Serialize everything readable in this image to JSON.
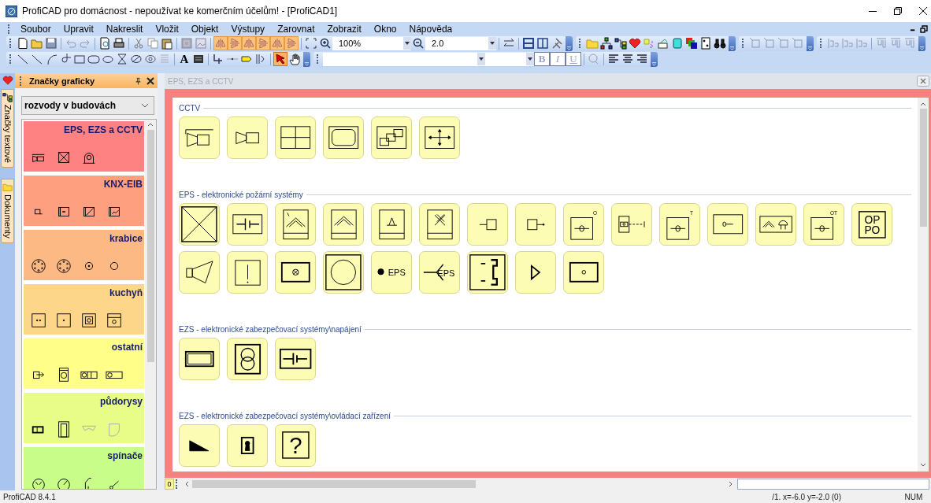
{
  "window": {
    "title": "ProfiCAD pro domácnost - nepoužívat ke komerčním účelům! - [ProfiCAD1]"
  },
  "menu": [
    "Soubor",
    "Upravit",
    "Nakreslit",
    "Vložit",
    "Objekt",
    "Výstupy",
    "Zarovnat",
    "Zobrazit",
    "Okno",
    "Nápověda"
  ],
  "toolbar": {
    "zoom": "100%",
    "grid": "2.0"
  },
  "drawing_toolbar": [
    {
      "kind": "line",
      "selected": false
    },
    {
      "kind": "polyline",
      "selected": false
    },
    {
      "kind": "arc",
      "selected": false
    },
    {
      "kind": "curve",
      "selected": false
    },
    {
      "kind": "rect",
      "selected": false
    },
    {
      "kind": "roundrect",
      "selected": false
    },
    {
      "kind": "ellipse",
      "selected": false
    },
    {
      "kind": "hourglass",
      "selected": false
    },
    {
      "kind": "slashcircle",
      "selected": false
    },
    {
      "kind": "eyecircle",
      "selected": false
    },
    {
      "kind": "lines",
      "selected": false
    },
    {
      "kind": "text",
      "label": "A",
      "selected": false
    },
    {
      "kind": "textbox",
      "selected": false
    },
    {
      "kind": "wire",
      "selected": false
    },
    {
      "kind": "node",
      "selected": false
    },
    {
      "kind": "tag",
      "selected": false
    },
    {
      "kind": "bus",
      "selected": false
    },
    {
      "kind": "pointer",
      "selected": true
    },
    {
      "kind": "hand",
      "selected": false
    }
  ],
  "format_toolbar": [
    {
      "kind": "bold",
      "label": "B",
      "disabled": true
    },
    {
      "kind": "italic",
      "label": "I",
      "disabled": true
    },
    {
      "kind": "underline",
      "label": "U",
      "disabled": true
    }
  ],
  "side_tabs": [
    {
      "label": "Značky textové"
    },
    {
      "label": "Dokumenty"
    }
  ],
  "panel": {
    "title": "Značky graficky",
    "library": "rozvody v budovách",
    "categories": [
      {
        "title": "EPS, EZS a CCTV",
        "color": "#ff8282",
        "symbols": [
          {
            "kind": "cam"
          },
          {
            "kind": "xbox"
          },
          {
            "kind": "dome"
          }
        ]
      },
      {
        "title": "KNX-EIB",
        "color": "#fe9f80",
        "symbols": [
          {
            "kind": "knxa"
          },
          {
            "kind": "knxb"
          },
          {
            "kind": "knxc"
          },
          {
            "kind": "knxd"
          }
        ]
      },
      {
        "title": "krabice",
        "color": "#fdb983",
        "symbols": [
          {
            "kind": "circle6"
          },
          {
            "kind": "circle6"
          },
          {
            "kind": "circledot"
          },
          {
            "kind": "circle"
          }
        ]
      },
      {
        "title": "kuchyň",
        "color": "#fed68a",
        "symbols": [
          {
            "kind": "socket2"
          },
          {
            "kind": "socket1"
          },
          {
            "kind": "socketring"
          },
          {
            "kind": "oven"
          }
        ]
      },
      {
        "title": "ostatní",
        "color": "#fefe88",
        "symbols": [
          {
            "kind": "plug"
          },
          {
            "kind": "clock"
          },
          {
            "kind": "washer2"
          },
          {
            "kind": "washer1"
          }
        ]
      },
      {
        "title": "půdorysy",
        "color": "#e8fd88",
        "symbols": [
          {
            "kind": "window"
          },
          {
            "kind": "door"
          },
          {
            "kind": "sink"
          },
          {
            "kind": "bath"
          }
        ]
      },
      {
        "title": "spínače",
        "color": "#c8fd8a",
        "symbols": [
          {
            "kind": "swdouble"
          },
          {
            "kind": "swdial"
          },
          {
            "kind": "swbent"
          },
          {
            "kind": "swkey"
          }
        ]
      }
    ]
  },
  "document": {
    "tab": "EPS, EZS a CCTV",
    "sections": [
      {
        "title": "CCTV",
        "symbols": [
          {
            "kind": "camera_housing"
          },
          {
            "kind": "camera"
          },
          {
            "kind": "monitor_cross"
          },
          {
            "kind": "monitor_rounded"
          },
          {
            "kind": "monitor_split"
          },
          {
            "kind": "monitor_arrows"
          }
        ]
      },
      {
        "title": "EPS - elektronické požární systémy",
        "symbols": [
          {
            "kind": "x_box"
          },
          {
            "kind": "battery_box"
          },
          {
            "kind": "smoke_detector"
          },
          {
            "kind": "chevron_detector"
          },
          {
            "kind": "flame_detector"
          },
          {
            "kind": "star_detector"
          },
          {
            "kind": "port_left"
          },
          {
            "kind": "port_right"
          },
          {
            "kind": "circle_line_box",
            "tag": "O"
          },
          {
            "kind": "rod_box"
          },
          {
            "kind": "circle_line_box",
            "tag": "T"
          },
          {
            "kind": "key_box"
          },
          {
            "kind": "chevron_mushroom"
          },
          {
            "kind": "circle_line_box",
            "tag": "OT"
          },
          {
            "kind": "text_box",
            "text": [
              "OP",
              "PO"
            ]
          },
          {
            "kind": "horn"
          },
          {
            "kind": "exclamation_box"
          },
          {
            "kind": "cross_circle_box"
          },
          {
            "kind": "circle_box"
          },
          {
            "kind": "dot_text",
            "text": [
              "EPS"
            ]
          },
          {
            "kind": "fork_text",
            "text": [
              "EPS"
            ]
          },
          {
            "kind": "bracket_box"
          },
          {
            "kind": "triangle"
          },
          {
            "kind": "small_circle_box"
          }
        ]
      },
      {
        "title": "EZS - elektronické zabezpečovací systémy\\napájení",
        "symbols": [
          {
            "kind": "rect_box"
          },
          {
            "kind": "transformer"
          },
          {
            "kind": "battery_cell"
          }
        ]
      },
      {
        "title": "EZS - elektronické zabezpečovací systémy\\ovládací zařízení",
        "symbols": [
          {
            "kind": "wedge"
          },
          {
            "kind": "keyhole_box"
          },
          {
            "kind": "text_box",
            "text": [
              "?"
            ]
          }
        ]
      }
    ]
  },
  "page_tab": "0",
  "status_bar": {
    "app": "ProfiCAD 8.4.1",
    "position": "/1. x=-6.0 y=-2.0 (0)",
    "mode": "NUM"
  }
}
